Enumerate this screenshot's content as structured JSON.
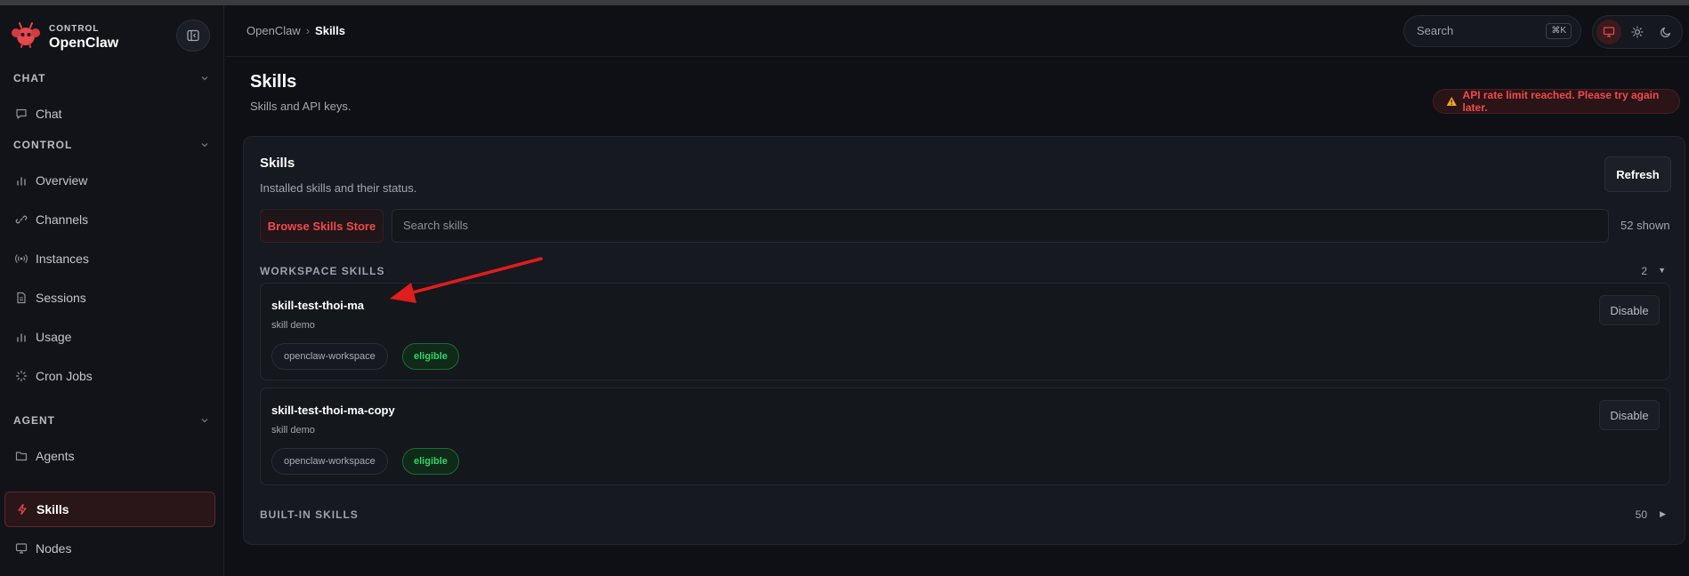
{
  "brand": {
    "sub": "CONTROL",
    "name": "OpenClaw",
    "accent": "#e5484d"
  },
  "sidebar": {
    "sections": [
      {
        "label": "CHAT",
        "items": [
          {
            "label": "Chat",
            "icon": "chat-icon"
          }
        ]
      },
      {
        "label": "CONTROL",
        "items": [
          {
            "label": "Overview",
            "icon": "bar-chart-icon"
          },
          {
            "label": "Channels",
            "icon": "link-icon"
          },
          {
            "label": "Instances",
            "icon": "broadcast-icon"
          },
          {
            "label": "Sessions",
            "icon": "document-icon"
          },
          {
            "label": "Usage",
            "icon": "bar-chart-icon"
          },
          {
            "label": "Cron Jobs",
            "icon": "loader-icon"
          }
        ]
      },
      {
        "label": "AGENT",
        "items": [
          {
            "label": "Agents",
            "icon": "folder-icon"
          },
          {
            "label": "Skills",
            "icon": "lightning-icon",
            "active": true
          },
          {
            "label": "Nodes",
            "icon": "monitor-icon"
          }
        ]
      }
    ]
  },
  "header": {
    "breadcrumb": {
      "root": "OpenClaw",
      "separator": "›",
      "current": "Skills"
    },
    "search": {
      "placeholder": "Search",
      "shortcut": "⌘K"
    },
    "theme": {
      "options": [
        "system",
        "light",
        "dark"
      ],
      "selected": "system"
    }
  },
  "page": {
    "title": "Skills",
    "subtitle": "Skills and API keys.",
    "alert": "API rate limit reached. Please try again later."
  },
  "card": {
    "title": "Skills",
    "subtitle": "Installed skills and their status.",
    "refresh_label": "Refresh",
    "browse_label": "Browse Skills Store",
    "search_placeholder": "Search skills",
    "shown": "52 shown"
  },
  "groups": {
    "workspace": {
      "label": "WORKSPACE SKILLS",
      "count": "2",
      "expanded": true,
      "skills": [
        {
          "name": "skill-test-thoi-ma",
          "desc": "skill demo",
          "source": "openclaw-workspace",
          "status": "eligible",
          "action": "Disable"
        },
        {
          "name": "skill-test-thoi-ma-copy",
          "desc": "skill demo",
          "source": "openclaw-workspace",
          "status": "eligible",
          "action": "Disable"
        }
      ]
    },
    "builtin": {
      "label": "BUILT-IN SKILLS",
      "count": "50",
      "expanded": false
    }
  },
  "colors": {
    "accent": "#e5484d",
    "eligible": "#35d36a",
    "alert": "#f04b4b",
    "annotation_arrow": "#e11d1d"
  }
}
